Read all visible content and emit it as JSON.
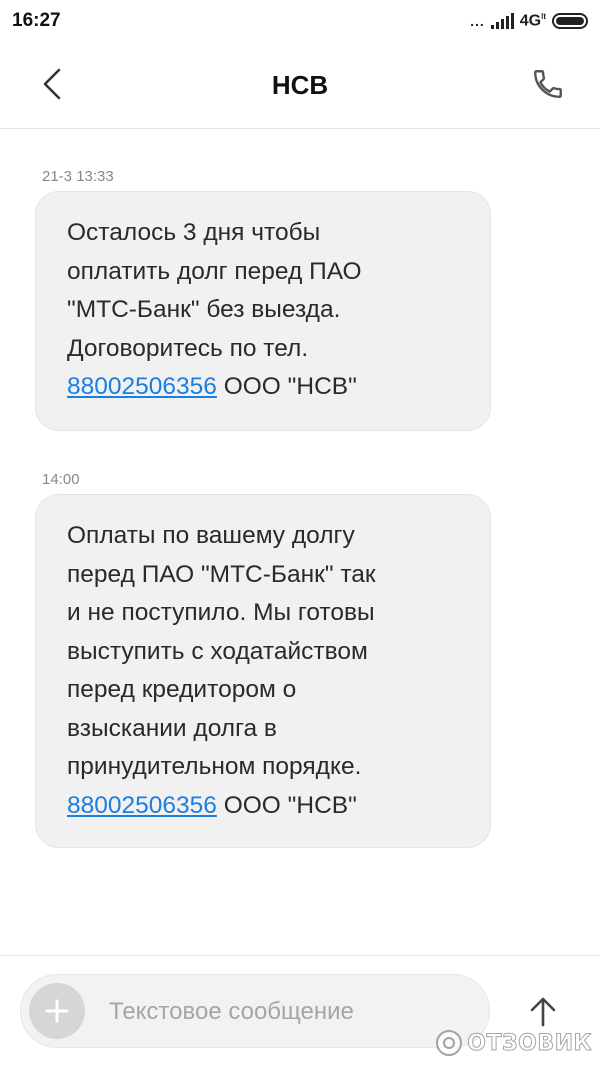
{
  "status_bar": {
    "time": "16:27",
    "dots": "...",
    "network": "4G",
    "network_sup": "lt"
  },
  "header": {
    "title": "НСВ",
    "back_icon": "chevron-left-icon",
    "call_icon": "phone-icon"
  },
  "messages": [
    {
      "timestamp": "21-3 13:33",
      "lines": [
        "Осталось 3 дня чтобы",
        "оплатить долг перед ПАО",
        "\"МТС-Банк\" без выезда.",
        "Договоритесь по тел."
      ],
      "phone": "88002506356",
      "suffix": " ООО \"НСВ\""
    },
    {
      "timestamp": "14:00",
      "lines": [
        "Оплаты по вашему долгу",
        "перед ПАО \"МТС-Банк\" так",
        "и не поступило. Мы готовы",
        "выступить с ходатайством",
        "перед кредитором о",
        "взыскании долга в",
        "принудительном порядке."
      ],
      "phone": "88002506356",
      "suffix": " ООО \"НСВ\""
    }
  ],
  "composer": {
    "placeholder": "Текстовое сообщение",
    "value": "",
    "add_icon": "plus-icon",
    "send_icon": "arrow-up-icon"
  },
  "watermark": {
    "text": "ОТЗОВИК"
  },
  "colors": {
    "link": "#1a7fe0",
    "bubble_bg": "#f1f1f1",
    "timestamp": "#888888"
  }
}
